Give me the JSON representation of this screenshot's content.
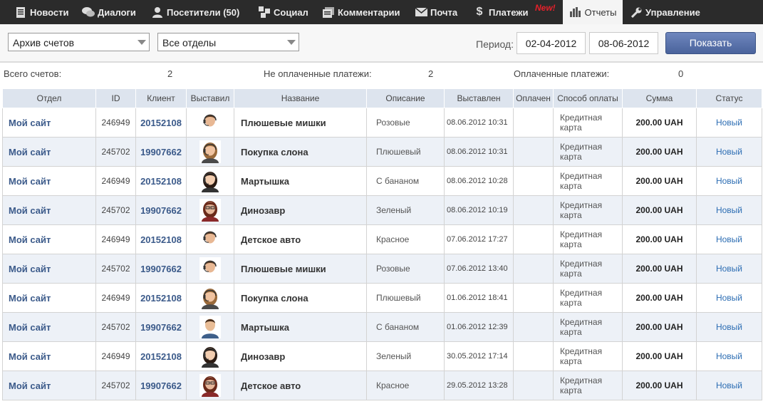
{
  "nav": {
    "items": [
      {
        "label": "Новости",
        "icon": "news-icon"
      },
      {
        "label": "Диалоги",
        "icon": "dialogs-icon"
      },
      {
        "label": "Посетители (50)",
        "icon": "visitors-icon"
      },
      {
        "label": "Социал",
        "icon": "social-icon"
      },
      {
        "label": "Комментарии",
        "icon": "comments-icon"
      },
      {
        "label": "Почта",
        "icon": "mail-icon"
      },
      {
        "label": "Платежи",
        "icon": "dollar-icon",
        "badge": "New!"
      },
      {
        "label": "Отчеты",
        "icon": "bar-chart-icon",
        "active": true
      },
      {
        "label": "Управление",
        "icon": "wrench-icon"
      }
    ]
  },
  "filters": {
    "archive_select": "Архив счетов",
    "department_select": "Все отделы",
    "period_label": "Период:",
    "date_from": "02-04-2012",
    "date_to": "08-06-2012",
    "show_button": "Показать"
  },
  "summary": {
    "total_label": "Всего счетов:",
    "total_value": "2",
    "unpaid_label": "Не оплаченные платежи:",
    "unpaid_value": "2",
    "paid_label": "Оплаченные платежи:",
    "paid_value": "0"
  },
  "table": {
    "columns": [
      "Отдел",
      "ID",
      "Клиент",
      "Выставил",
      "Название",
      "Описание",
      "Выставлен",
      "Оплачен",
      "Способ оплаты",
      "Сумма",
      "Статус"
    ],
    "rows": [
      {
        "dept": "Мой сайт",
        "id": "246949",
        "client": "20152108",
        "avatar": "operator-male-headset",
        "name": "Плюшевые мишки",
        "desc": "Розовые",
        "issued": "08.06.2012 10:31",
        "paid": "",
        "method": "Кредитная карта",
        "sum": "200.00 UAH",
        "status": "Новый"
      },
      {
        "dept": "Мой сайт",
        "id": "245702",
        "client": "19907662",
        "avatar": "operator-female-headset",
        "name": "Покупка слона",
        "desc": "Плюшевый",
        "issued": "08.06.2012 10:31",
        "paid": "",
        "method": "Кредитная карта",
        "sum": "200.00 UAH",
        "status": "Новый"
      },
      {
        "dept": "Мой сайт",
        "id": "246949",
        "client": "20152108",
        "avatar": "operator-female-dark",
        "name": "Мартышка",
        "desc": "С бананом",
        "issued": "08.06.2012 10:28",
        "paid": "",
        "method": "Кредитная карта",
        "sum": "200.00 UAH",
        "status": "Новый"
      },
      {
        "dept": "Мой сайт",
        "id": "245702",
        "client": "19907662",
        "avatar": "operator-female-glasses",
        "name": "Динозавр",
        "desc": "Зеленый",
        "issued": "08.06.2012 10:19",
        "paid": "",
        "method": "Кредитная карта",
        "sum": "200.00 UAH",
        "status": "Новый"
      },
      {
        "dept": "Мой сайт",
        "id": "246949",
        "client": "20152108",
        "avatar": "operator-male-headset",
        "name": "Детское авто",
        "desc": "Красное",
        "issued": "07.06.2012 17:27",
        "paid": "",
        "method": "Кредитная карта",
        "sum": "200.00 UAH",
        "status": "Новый"
      },
      {
        "dept": "Мой сайт",
        "id": "245702",
        "client": "19907662",
        "avatar": "operator-male-headset",
        "name": "Плюшевые мишки",
        "desc": "Розовые",
        "issued": "07.06.2012 13:40",
        "paid": "",
        "method": "Кредитная карта",
        "sum": "200.00 UAH",
        "status": "Новый"
      },
      {
        "dept": "Мой сайт",
        "id": "246949",
        "client": "20152108",
        "avatar": "operator-female-headset",
        "name": "Покупка слона",
        "desc": "Плюшевый",
        "issued": "01.06.2012 18:41",
        "paid": "",
        "method": "Кредитная карта",
        "sum": "200.00 UAH",
        "status": "Новый"
      },
      {
        "dept": "Мой сайт",
        "id": "245702",
        "client": "19907662",
        "avatar": "operator-male-smile",
        "name": "Мартышка",
        "desc": "С бананом",
        "issued": "01.06.2012 12:39",
        "paid": "",
        "method": "Кредитная карта",
        "sum": "200.00 UAH",
        "status": "Новый"
      },
      {
        "dept": "Мой сайт",
        "id": "246949",
        "client": "20152108",
        "avatar": "operator-female-dark",
        "name": "Динозавр",
        "desc": "Зеленый",
        "issued": "30.05.2012 17:14",
        "paid": "",
        "method": "Кредитная карта",
        "sum": "200.00 UAH",
        "status": "Новый"
      },
      {
        "dept": "Мой сайт",
        "id": "245702",
        "client": "19907662",
        "avatar": "operator-female-glasses",
        "name": "Детское авто",
        "desc": "Красное",
        "issued": "29.05.2012 13:28",
        "paid": "",
        "method": "Кредитная карта",
        "sum": "200.00 UAH",
        "status": "Новый"
      }
    ]
  },
  "colors": {
    "nav_bg": "#2b2b2b",
    "header_row": "#dde4ee",
    "alt_row": "#edf1f7",
    "link": "#3b5a8a",
    "status": "#2c6db3",
    "badge": "#e8202a",
    "button": "#4a639c"
  }
}
